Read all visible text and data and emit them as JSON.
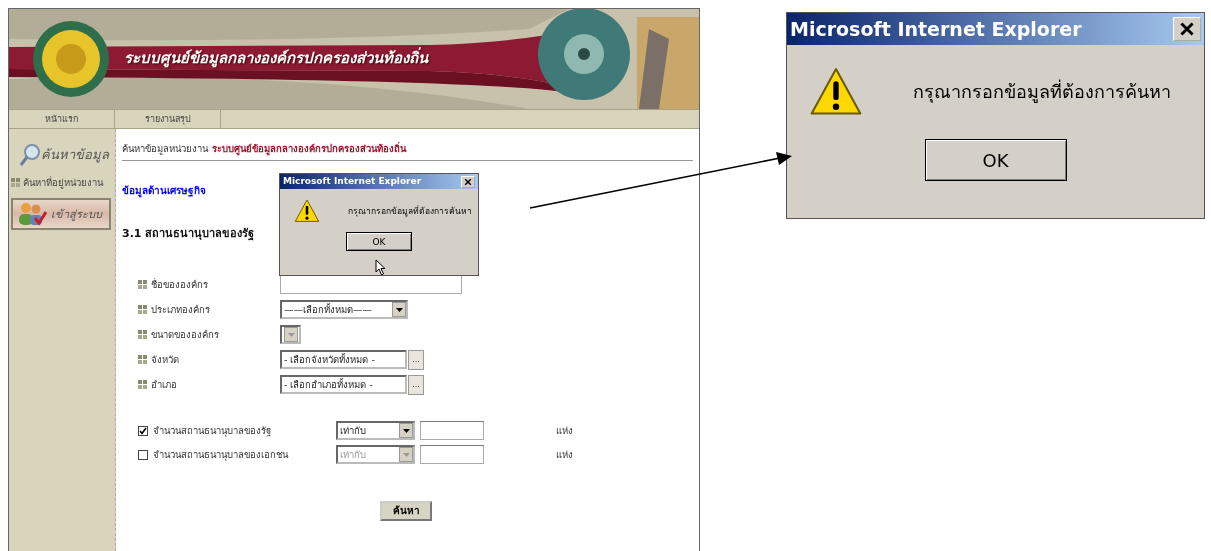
{
  "banner": {
    "title": "ระบบศูนย์ข้อมูลกลางองค์กรปกครองส่วนท้องถิ่น"
  },
  "nav_tabs": [
    {
      "label": "หน้าแรก"
    },
    {
      "label": "รายงานสรุป"
    }
  ],
  "sidebar": {
    "heading": "ค้นหาข้อมูล",
    "items": [
      "ค้นหาที่อยู่หน่วยงาน"
    ],
    "login_button": "เข้าสู่ระบบ"
  },
  "breadcrumb": {
    "label": "ค้นหาข้อมูลหน่วยงาน",
    "system_name": "ระบบศูนย์ข้อมูลกลางองค์กรปกครองส่วนท้องถิ่น"
  },
  "section_title": "ข้อมูลด้านเศรษฐกิจ",
  "subsection_title": "3.1 สถานธนานุบาลของรัฐ",
  "filters": [
    {
      "label": "ชื่อขององค์กร",
      "kind": "text"
    },
    {
      "label": "ประเภทองค์กร",
      "kind": "select",
      "value": "——เลือกทั้งหมด——"
    },
    {
      "label": "ขนาดขององค์กร",
      "kind": "small_select"
    },
    {
      "label": "จังหวัด",
      "kind": "picker",
      "value": "- เลือกจังหวัดทั้งหมด -",
      "button": "..."
    },
    {
      "label": "อำเภอ",
      "kind": "picker",
      "value": "- เลือกอำเภอทั้งหมด -",
      "button": "..."
    }
  ],
  "criteria": [
    {
      "checked": true,
      "label": "จำนวนสถานธนานุบาลของรัฐ",
      "operator": "เท่ากับ",
      "disabled": false,
      "unit": "แห่ง"
    },
    {
      "checked": false,
      "label": "จำนวนสถานธนานุบาลของเอกชน",
      "operator": "เท่ากับ",
      "disabled": true,
      "unit": "แห่ง"
    }
  ],
  "search_button": "ค้นหา",
  "dialog": {
    "title": "Microsoft Internet Explorer",
    "message": "กรุณากรอกข้อมูลที่ต้องการค้นหา",
    "ok": "OK"
  },
  "zoomed_dialog": {
    "title": "Microsoft Internet Explorer",
    "message": "กรุณากรอกข้อมูลที่ต้องการค้นหา",
    "ok": "OK"
  }
}
